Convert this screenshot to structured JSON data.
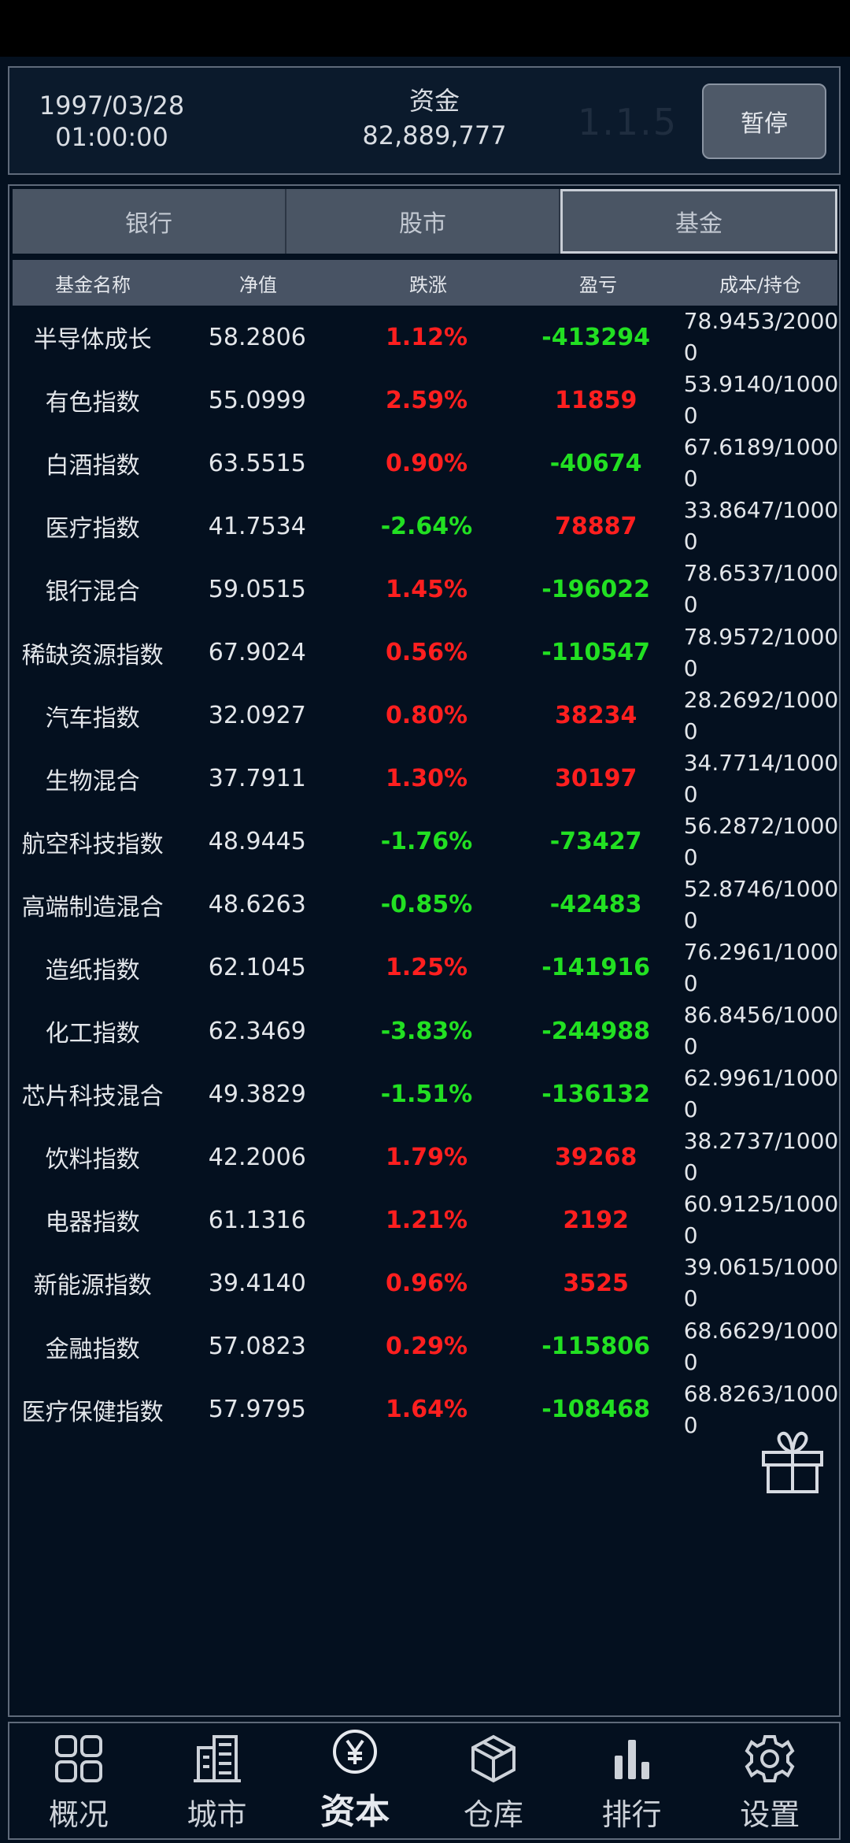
{
  "header": {
    "date": "1997/03/28",
    "time": "01:00:00",
    "funds_label": "资金",
    "funds_value": "82,889,777",
    "version": "1.1.5",
    "pause_label": "暂停"
  },
  "tabs": [
    {
      "label": "银行",
      "active": false
    },
    {
      "label": "股市",
      "active": false
    },
    {
      "label": "基金",
      "active": true
    }
  ],
  "table": {
    "columns": [
      "基金名称",
      "净值",
      "跌涨",
      "盈亏",
      "成本/持仓"
    ],
    "rows": [
      {
        "name": "半导体成长",
        "nav": "58.2806",
        "change": "1.12%",
        "pnl": "-413294",
        "cost": "78.9453/2000\n0"
      },
      {
        "name": "有色指数",
        "nav": "55.0999",
        "change": "2.59%",
        "pnl": "11859",
        "cost": "53.9140/1000\n0"
      },
      {
        "name": "白酒指数",
        "nav": "63.5515",
        "change": "0.90%",
        "pnl": "-40674",
        "cost": "67.6189/1000\n0"
      },
      {
        "name": "医疗指数",
        "nav": "41.7534",
        "change": "-2.64%",
        "pnl": "78887",
        "cost": "33.8647/1000\n0"
      },
      {
        "name": "银行混合",
        "nav": "59.0515",
        "change": "1.45%",
        "pnl": "-196022",
        "cost": "78.6537/1000\n0"
      },
      {
        "name": "稀缺资源指数",
        "nav": "67.9024",
        "change": "0.56%",
        "pnl": "-110547",
        "cost": "78.9572/1000\n0"
      },
      {
        "name": "汽车指数",
        "nav": "32.0927",
        "change": "0.80%",
        "pnl": "38234",
        "cost": "28.2692/1000\n0"
      },
      {
        "name": "生物混合",
        "nav": "37.7911",
        "change": "1.30%",
        "pnl": "30197",
        "cost": "34.7714/1000\n0"
      },
      {
        "name": "航空科技指数",
        "nav": "48.9445",
        "change": "-1.76%",
        "pnl": "-73427",
        "cost": "56.2872/1000\n0"
      },
      {
        "name": "高端制造混合",
        "nav": "48.6263",
        "change": "-0.85%",
        "pnl": "-42483",
        "cost": "52.8746/1000\n0"
      },
      {
        "name": "造纸指数",
        "nav": "62.1045",
        "change": "1.25%",
        "pnl": "-141916",
        "cost": "76.2961/1000\n0"
      },
      {
        "name": "化工指数",
        "nav": "62.3469",
        "change": "-3.83%",
        "pnl": "-244988",
        "cost": "86.8456/1000\n0"
      },
      {
        "name": "芯片科技混合",
        "nav": "49.3829",
        "change": "-1.51%",
        "pnl": "-136132",
        "cost": "62.9961/1000\n0"
      },
      {
        "name": "饮料指数",
        "nav": "42.2006",
        "change": "1.79%",
        "pnl": "39268",
        "cost": "38.2737/1000\n0"
      },
      {
        "name": "电器指数",
        "nav": "61.1316",
        "change": "1.21%",
        "pnl": "2192",
        "cost": "60.9125/1000\n0"
      },
      {
        "name": "新能源指数",
        "nav": "39.4140",
        "change": "0.96%",
        "pnl": "3525",
        "cost": "39.0615/1000\n0"
      },
      {
        "name": "金融指数",
        "nav": "57.0823",
        "change": "0.29%",
        "pnl": "-115806",
        "cost": "68.6629/1000\n0"
      },
      {
        "name": "医疗保健指数",
        "nav": "57.9795",
        "change": "1.64%",
        "pnl": "-108468",
        "cost": "68.8263/1000\n0"
      }
    ]
  },
  "colors": {
    "up": "#ff1f1f",
    "down": "#22e022"
  },
  "gift_icon": "gift-icon",
  "nav": [
    {
      "label": "概况",
      "icon": "grid-icon",
      "active": false
    },
    {
      "label": "城市",
      "icon": "building-icon",
      "active": false
    },
    {
      "label": "资本",
      "icon": "yen-coin-icon",
      "active": true
    },
    {
      "label": "仓库",
      "icon": "box-icon",
      "active": false
    },
    {
      "label": "排行",
      "icon": "bar-chart-icon",
      "active": false
    },
    {
      "label": "设置",
      "icon": "gear-icon",
      "active": false
    }
  ]
}
